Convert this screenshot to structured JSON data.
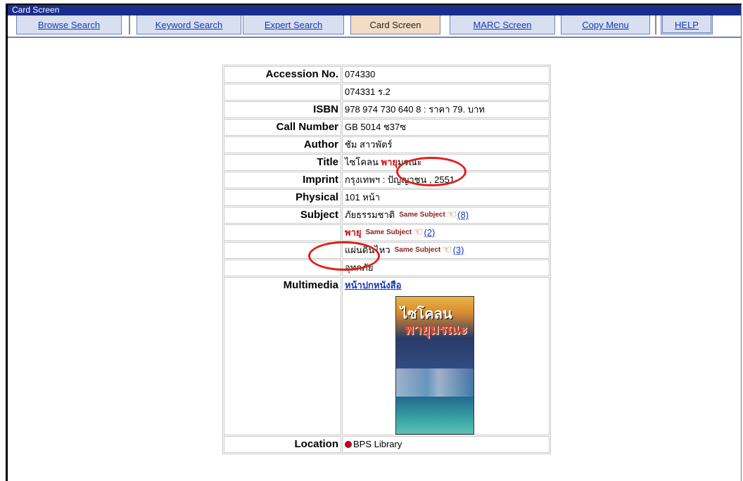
{
  "window": {
    "title": "Card Screen"
  },
  "tabs": [
    {
      "label": "Browse Search"
    },
    {
      "label": "Keyword Search"
    },
    {
      "label": "Expert Search"
    },
    {
      "label": "Card Screen"
    },
    {
      "label": "MARC Screen"
    },
    {
      "label": "Copy Menu"
    },
    {
      "label": "HELP"
    }
  ],
  "card": {
    "accession_label": "Accession No.",
    "accession_1": "074330",
    "accession_2": "074331 ร.2",
    "isbn_label": "ISBN",
    "isbn": "978 974 730 640 8 : ราคา 79. บาท",
    "call_label": "Call Number",
    "call": "GB 5014 ช37ซ",
    "author_label": "Author",
    "author": "ชัม สาวพัตร์",
    "title_label": "Title",
    "title_pre": "ไซโคลน ",
    "title_highlight": "พายุ",
    "title_post": "มรณะ",
    "imprint_label": "Imprint",
    "imprint": "กรุงเทพฯ : ปัญญาชน , 2551",
    "physical_label": "Physical",
    "physical": "101 หน้า",
    "subject_label": "Subject",
    "subjects": [
      {
        "term": "ภัยธรรมชาติ",
        "same": "Same Subject",
        "count": "(8)"
      },
      {
        "term": "พายุ",
        "same": "Same Subject",
        "count": "(2)"
      },
      {
        "term": "แผ่นดินไหว",
        "same": "Same Subject",
        "count": "(3)"
      },
      {
        "term": "อุทกภัย"
      }
    ],
    "multimedia_label": "Multimedia",
    "multimedia_link": "หน้าปกหนังสือ",
    "cover_title_1": "ไซโคลน",
    "cover_title_2": "พายุมรณะ",
    "location_label": "Location",
    "location": "BPS Library"
  },
  "colors": {
    "titlebar": "#1a2e8c",
    "tab": "#d8dff0",
    "tab_active": "#f2dcc3",
    "link": "#1639b8",
    "highlight": "#e0201a"
  },
  "icons": {
    "same_subject": "pointing-hand-icon",
    "location": "red-dot-icon"
  }
}
